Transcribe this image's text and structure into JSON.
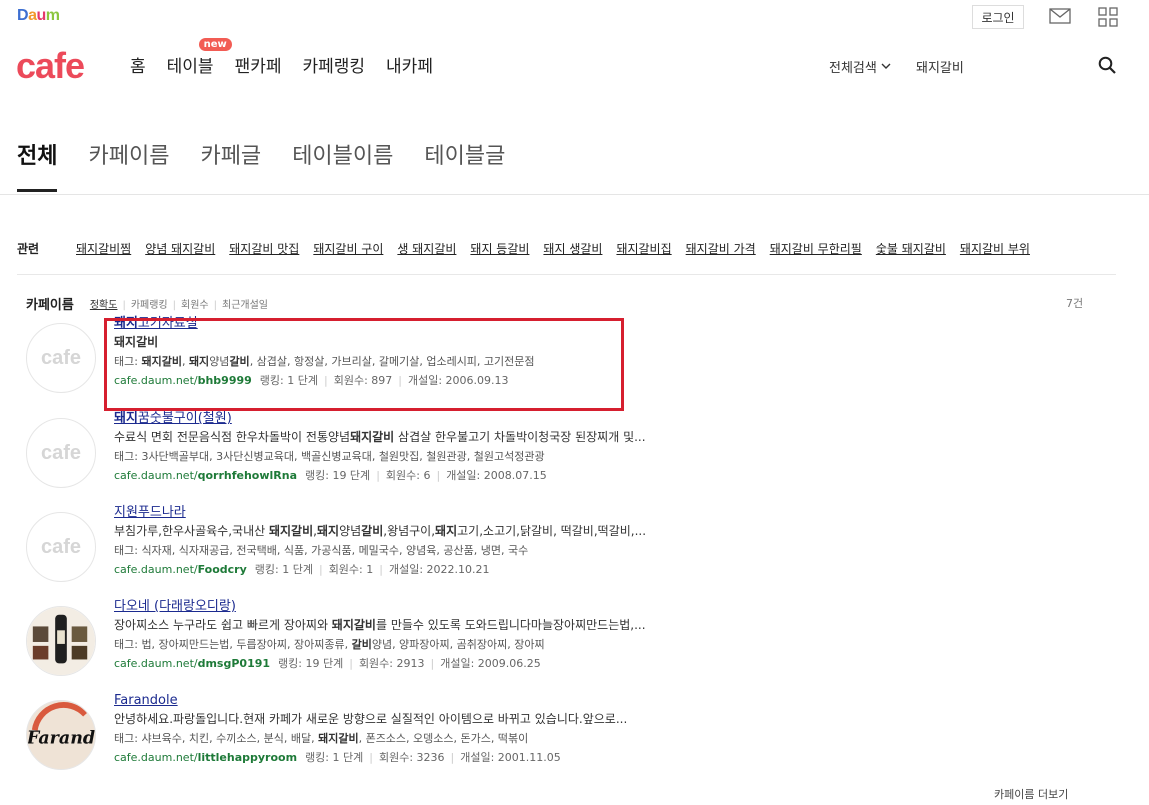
{
  "brand": {
    "daum_letters": [
      "D",
      "a",
      "u",
      "m"
    ],
    "daum_colors": [
      "#3d6fd1",
      "#f29a2e",
      "#e5396b",
      "#8cc63f"
    ],
    "cafe": "cafe",
    "cafe_color": "#ec4a5a"
  },
  "header": {
    "login_label": "로그인",
    "icons": [
      "mail-icon",
      "app-grid-icon",
      "search-icon"
    ]
  },
  "gnb": {
    "items": [
      {
        "label": "홈"
      },
      {
        "label": "테이블",
        "badge": "new"
      },
      {
        "label": "팬카페"
      },
      {
        "label": "카페랭킹"
      },
      {
        "label": "내카페"
      }
    ]
  },
  "search": {
    "scope": "전체검색",
    "query": "돼지갈비"
  },
  "tabs": [
    {
      "label": "전체",
      "active": true
    },
    {
      "label": "카페이름"
    },
    {
      "label": "카페글"
    },
    {
      "label": "테이블이름"
    },
    {
      "label": "테이블글"
    }
  ],
  "related": {
    "title": "관련",
    "links": [
      "돼지갈비찜",
      "양념 돼지갈비",
      "돼지갈비 맛집",
      "돼지갈비 구이",
      "생 돼지갈비",
      "돼지 등갈비",
      "돼지 생갈비",
      "돼지갈비집",
      "돼지갈비 가격",
      "돼지갈비 무한리필",
      "숯불 돼지갈비",
      "돼지갈비 부위"
    ]
  },
  "section": {
    "title": "카페이름",
    "sort": [
      "정확도",
      "카페랭킹",
      "회원수",
      "최근개설일"
    ],
    "count": "7건",
    "more": "카페이름 더보기"
  },
  "results": [
    {
      "title_bold": "돼지",
      "title_rest": "고기자료실",
      "desc": "돼지갈비",
      "tags_prefix": "태그: ",
      "tags_rich": "<b>돼지갈비</b>, <b>돼지</b>양념<b>갈비</b>, 삼겹살, 항정살, 가브리살, 갈메기살, 업소레시피, 고기전문점",
      "url_prefix": "cafe.daum.net/",
      "url_id": "bhb9999",
      "rank": "랭킹: 1 단계",
      "members": "회원수: 897",
      "opened": "개설일: 2006.09.13",
      "thumb": "cafe"
    },
    {
      "title_bold": "돼지",
      "title_rest": "꿈숫불구이(철원)",
      "desc_rich": "수료식 면회 전문음식점 한우차돌박이 전통양념<b>돼지갈비</b> 삼겹살 한우불고기 차돌박이청국장 된장찌개 및...",
      "tags": "태그: 3사단백골부대, 3사단신병교육대, 백골신병교육대, 철원맛집, 철원관광, 철원고석정관광",
      "url_prefix": "cafe.daum.net/",
      "url_id": "qorrhfehowlRna",
      "rank": "랭킹: 19 단계",
      "members": "회원수: 6",
      "opened": "개설일: 2008.07.15",
      "thumb": "cafe"
    },
    {
      "title_bold": "",
      "title_rest": "지원푸드나라",
      "desc_rich": "부침가루,한우사골육수,국내산 <b>돼지갈비</b>,<b>돼지</b>양념<b>갈비</b>,왕념구이,<b>돼지</b>고기,소고기,닭갈비, 떡갈비,떡갈비,...",
      "tags": "태그: 식자재, 식자재공급, 전국택배, 식품, 가공식품, 메밀국수, 양념육, 공산품, 냉면, 국수",
      "url_prefix": "cafe.daum.net/",
      "url_id": "Foodcry",
      "rank": "랭킹: 1 단계",
      "members": "회원수: 1",
      "opened": "개설일: 2022.10.21",
      "thumb": "cafe"
    },
    {
      "title_bold": "",
      "title_rest": "다오네 (다래랑오디랑)",
      "desc_rich": "장아찌소스 누구라도 쉽고 빠르게 장아찌와 <b>돼지갈비</b>를 만들수 있도록 도와드립니다마늘장아찌만드는법,...",
      "tags_rich": "태그: 법, 장아찌만드는법, 두릅장아찌, 장아찌종류, <b>갈비</b>양념, 양파장아찌, 곰취장아찌, 장아찌",
      "url_prefix": "cafe.daum.net/",
      "url_id": "dmsgP0191",
      "rank": "랭킹: 19 단계",
      "members": "회원수: 2913",
      "opened": "개설일: 2009.06.25",
      "thumb": "photo"
    },
    {
      "title_bold": "",
      "title_rest": "Farandole",
      "desc": "안녕하세요.파랑돌입니다.현재 카페가 새로운 방향으로 실질적인 아이템으로 바뀌고 있습니다.앞으로...",
      "tags_rich": "태그: 샤브육수, 치킨, 수끼소스, 분식, 배달, <b>돼지갈비</b>, 폰즈소스, 오뎅소스, 돈가스, 떡볶이",
      "url_prefix": "cafe.daum.net/",
      "url_id": "littlehappyroom",
      "rank": "랭킹: 1 단계",
      "members": "회원수: 3236",
      "opened": "개설일: 2001.11.05",
      "thumb": "logo",
      "thumb_text": "Farand"
    }
  ]
}
